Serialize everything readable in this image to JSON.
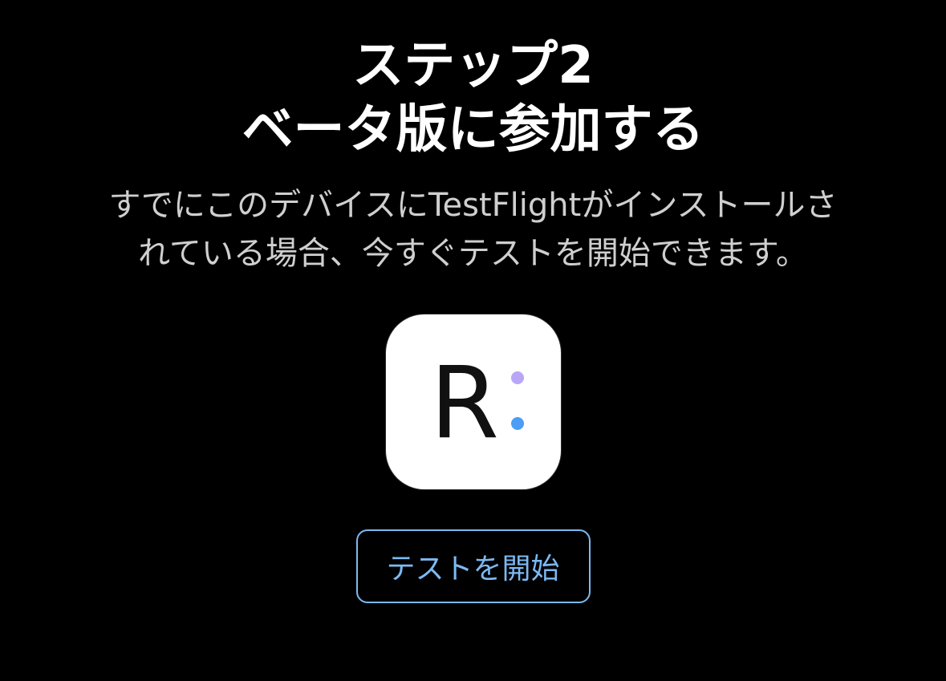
{
  "title": {
    "line1": "ステップ2",
    "line2": "ベータ版に参加する"
  },
  "description": {
    "line1": "すでにこのデバイスにTestFlightがインストールさ",
    "line2": "れている場合、今すぐテストを開始できます。"
  },
  "app_icon": {
    "letter": "R",
    "dot_top_color": "#b9a6f5",
    "dot_bottom_color": "#4c9df5"
  },
  "start_button": {
    "label": "テストを開始"
  },
  "colors": {
    "background": "#000000",
    "title": "#ffffff",
    "description": "#cfcfcf",
    "accent": "#7cb9f2"
  }
}
